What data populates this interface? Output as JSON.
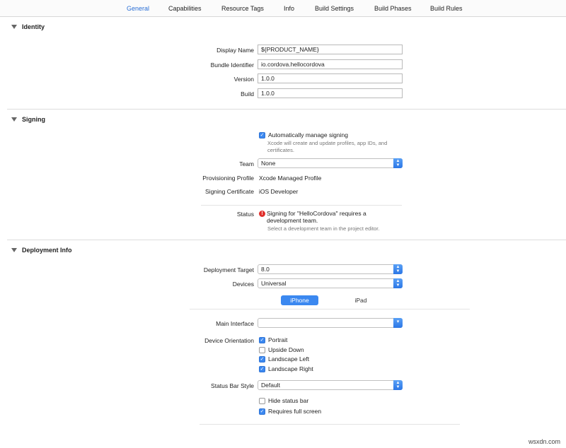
{
  "tabs": [
    "General",
    "Capabilities",
    "Resource Tags",
    "Info",
    "Build Settings",
    "Build Phases",
    "Build Rules"
  ],
  "identity": {
    "title": "Identity",
    "display_name_label": "Display Name",
    "display_name_value": "${PRODUCT_NAME}",
    "bundle_id_label": "Bundle Identifier",
    "bundle_id_value": "io.cordova.hellocordova",
    "version_label": "Version",
    "version_value": "1.0.0",
    "build_label": "Build",
    "build_value": "1.0.0"
  },
  "signing": {
    "title": "Signing",
    "auto_label": "Automatically manage signing",
    "auto_checked": true,
    "auto_hint": "Xcode will create and update profiles, app IDs, and certificates.",
    "team_label": "Team",
    "team_value": "None",
    "profile_label": "Provisioning Profile",
    "profile_value": "Xcode Managed Profile",
    "cert_label": "Signing Certificate",
    "cert_value": "iOS Developer",
    "status_label": "Status",
    "status_error": "Signing for \"HelloCordova\" requires a development team.",
    "status_hint": "Select a development team in the project editor.",
    "error_color": "#e0302c"
  },
  "deployment": {
    "title": "Deployment Info",
    "target_label": "Deployment Target",
    "target_value": "8.0",
    "devices_label": "Devices",
    "devices_value": "Universal",
    "seg_iphone": "iPhone",
    "seg_ipad": "iPad",
    "main_interface_label": "Main Interface",
    "main_interface_value": "",
    "orientation_label": "Device Orientation",
    "orientations": [
      {
        "label": "Portrait",
        "checked": true
      },
      {
        "label": "Upside Down",
        "checked": false
      },
      {
        "label": "Landscape Left",
        "checked": true
      },
      {
        "label": "Landscape Right",
        "checked": true
      }
    ],
    "status_bar_label": "Status Bar Style",
    "status_bar_value": "Default",
    "hide_status_bar_label": "Hide status bar",
    "hide_status_bar_checked": false,
    "full_screen_label": "Requires full screen",
    "full_screen_checked": true
  },
  "accent_color": "#3b88f0",
  "watermark": "wsxdn.com"
}
